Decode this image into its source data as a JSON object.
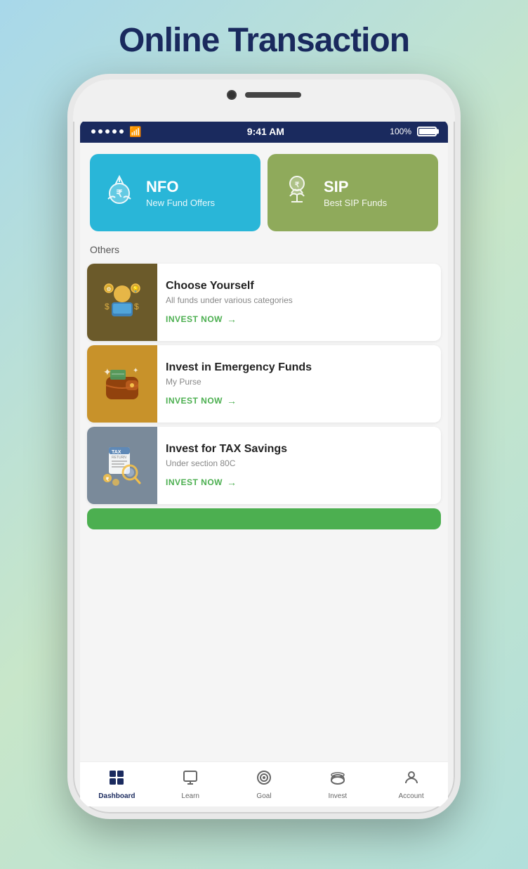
{
  "page": {
    "title": "Online Transaction",
    "background": "linear-gradient(135deg, #a8d8ea 0%, #c8e6c9 50%, #b2dfdb 100%)"
  },
  "status_bar": {
    "time": "9:41 AM",
    "battery": "100%",
    "signal_dots": 5
  },
  "top_cards": [
    {
      "id": "nfo",
      "title": "NFO",
      "subtitle": "New Fund Offers",
      "bg_color": "#29b6d8",
      "icon": "💰"
    },
    {
      "id": "sip",
      "title": "SIP",
      "subtitle": "Best SIP Funds",
      "bg_color": "#8faa5b",
      "icon": "🌱"
    }
  ],
  "others_label": "Others",
  "list_items": [
    {
      "id": "choose-yourself",
      "title": "Choose Yourself",
      "subtitle": "All funds under various categories",
      "cta": "INVEST NOW",
      "image_color": "brown",
      "icon": "🧑‍💼"
    },
    {
      "id": "emergency-funds",
      "title": "Invest in Emergency Funds",
      "subtitle": "My Purse",
      "cta": "INVEST NOW",
      "image_color": "gold",
      "icon": "👛"
    },
    {
      "id": "tax-savings",
      "title": "Invest for TAX Savings",
      "subtitle": "Under section 80C",
      "cta": "INVEST NOW",
      "image_color": "gray",
      "icon": "📋"
    }
  ],
  "bottom_nav": [
    {
      "id": "dashboard",
      "label": "Dashboard",
      "icon": "⊞",
      "active": true
    },
    {
      "id": "learn",
      "label": "Learn",
      "icon": "🖥",
      "active": false
    },
    {
      "id": "goal",
      "label": "Goal",
      "icon": "🎯",
      "active": false
    },
    {
      "id": "invest",
      "label": "Invest",
      "icon": "🐷",
      "active": false
    },
    {
      "id": "account",
      "label": "Account",
      "icon": "👤",
      "active": false
    }
  ]
}
